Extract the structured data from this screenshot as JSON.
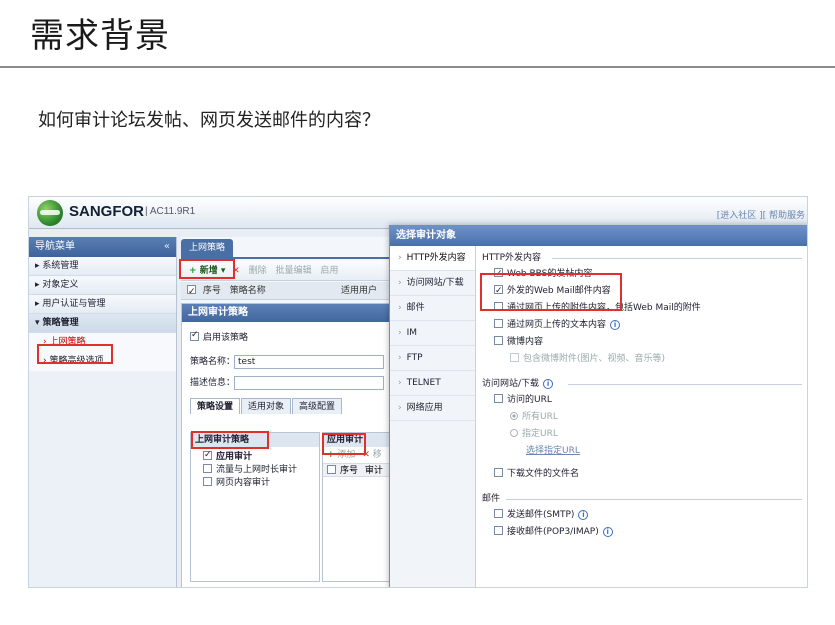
{
  "slide": {
    "title": "需求背景",
    "question": "如何审计论坛发帖、网页发送邮件的内容？"
  },
  "app": {
    "brand": "SANGFOR",
    "version": "| AC11.9R1",
    "top_links": "[进入社区 ][ 帮助服务"
  },
  "nav": {
    "header": "导航菜单",
    "collapse": "«",
    "items": [
      "▸ 系统管理",
      "▸ 对象定义",
      "▸ 用户认证与管理",
      "▾ 策略管理"
    ],
    "subitems": [
      "› 上网策略",
      "› 策略高级选项"
    ]
  },
  "middle": {
    "tab": "上网策略",
    "toolbar": {
      "add": "新增 ▾",
      "delete": "删除",
      "batch_edit": "批量编辑",
      "enable": "启用"
    },
    "grid_cols": {
      "seq": "序号",
      "name": "策略名称",
      "user": "适用用户"
    },
    "panel_title": "上网审计策略",
    "enable_label": "启用该策略",
    "name_label": "策略名称：",
    "name_value": "test",
    "desc_label": "描述信息：",
    "tabs": [
      "策略设置",
      "适用对象",
      "高级配置"
    ],
    "sub_panel": {
      "title": "上网审计策略",
      "items": [
        "应用审计",
        "流量与上网时长审计",
        "网页内容审计"
      ]
    },
    "app_panel": {
      "title": "应用审计",
      "add": "添加",
      "x": "✕",
      "x_trail": "移",
      "seq": "序号",
      "audit": "审计"
    }
  },
  "dialog": {
    "title": "选择审计对象",
    "categories": [
      "HTTP外发内容",
      "访问网站/下载",
      "邮件",
      "IM",
      "FTP",
      "TELNET",
      "网络应用"
    ],
    "arrow": "›",
    "http": {
      "title": "HTTP外发内容",
      "opt1": "Web BBS的发帖内容",
      "opt2": "外发的Web Mail邮件内容",
      "opt3": "通过网页上传的附件内容，包括Web Mail的附件",
      "opt4": "通过网页上传的文本内容",
      "opt5": "微博内容",
      "opt6": "包含微博附件(图片、视频、音乐等)"
    },
    "web": {
      "title": "访问网站/下载",
      "url": "访问的URL",
      "all_url": "所有URL",
      "spec_url": "指定URL",
      "choose_url": "选择指定URL",
      "download": "下载文件的文件名"
    },
    "mail": {
      "title": "邮件",
      "smtp": "发送邮件(SMTP)",
      "pop": "接收邮件(POP3/IMAP)"
    },
    "info_icon": "i"
  },
  "colors": {
    "highlight": "#e0302c",
    "header_blue": "#4a70aa"
  }
}
